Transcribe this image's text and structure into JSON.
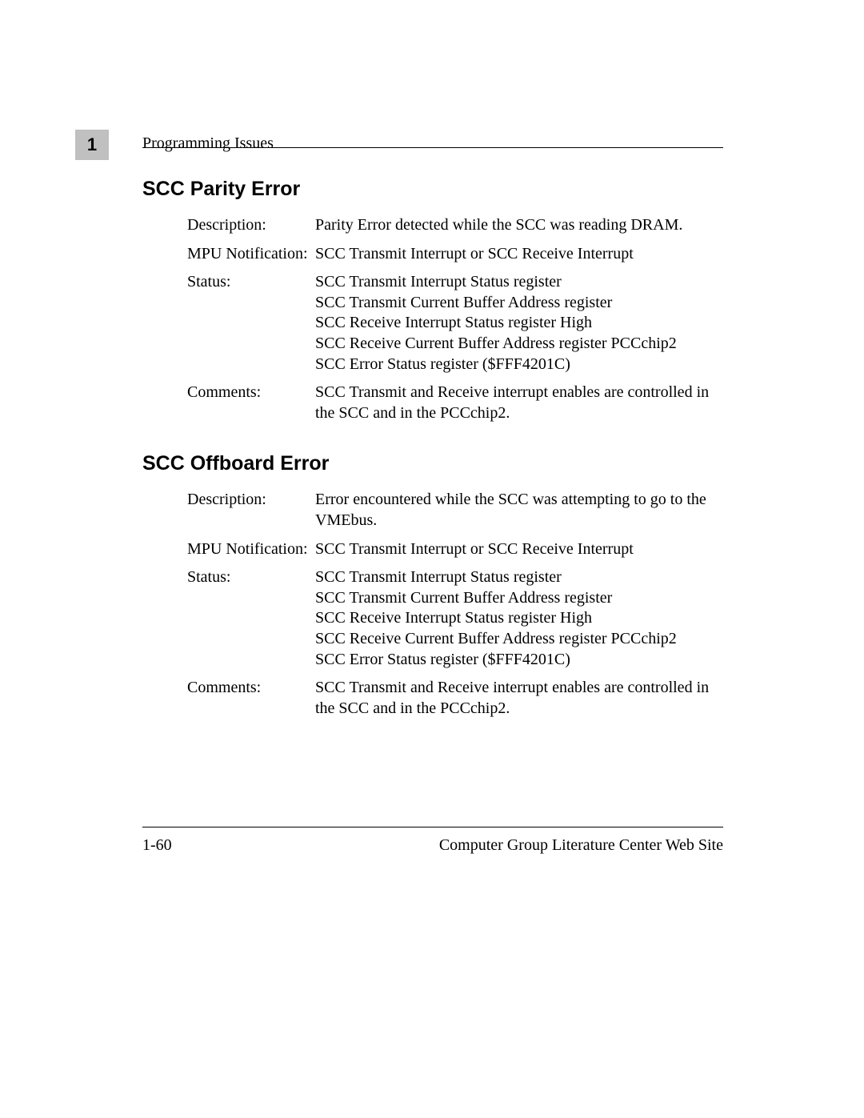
{
  "header": {
    "chapter_number": "1",
    "running_head": "Programming Issues"
  },
  "sections": [
    {
      "title": "SCC Parity Error",
      "rows": [
        {
          "label": "Description:",
          "lines": [
            "Parity Error detected while the SCC was reading DRAM."
          ]
        },
        {
          "label": "MPU Notification:",
          "lines": [
            "SCC Transmit Interrupt or SCC Receive Interrupt"
          ]
        },
        {
          "label": "Status:",
          "lines": [
            "SCC Transmit Interrupt Status register",
            "SCC Transmit Current Buffer Address register",
            "SCC Receive Interrupt Status register High",
            "SCC Receive Current Buffer Address register PCCchip2",
            "SCC Error Status register ($FFF4201C)"
          ]
        },
        {
          "label": "Comments:",
          "lines": [
            "SCC Transmit and Receive interrupt enables are controlled in the SCC and in the PCCchip2."
          ]
        }
      ]
    },
    {
      "title": "SCC Offboard Error",
      "rows": [
        {
          "label": "Description:",
          "lines": [
            "Error encountered while the SCC was attempting to go to the VMEbus."
          ]
        },
        {
          "label": "MPU Notification:",
          "lines": [
            "SCC Transmit Interrupt or SCC Receive Interrupt"
          ]
        },
        {
          "label": "Status:",
          "lines": [
            "SCC Transmit Interrupt Status register",
            "SCC Transmit Current Buffer Address register",
            "SCC Receive Interrupt Status register High",
            "SCC Receive Current Buffer Address register PCCchip2",
            "SCC Error Status register ($FFF4201C)"
          ]
        },
        {
          "label": "Comments:",
          "lines": [
            "SCC Transmit and Receive interrupt enables are controlled in the SCC and in the PCCchip2."
          ]
        }
      ]
    }
  ],
  "footer": {
    "left": "1-60",
    "right": "Computer Group Literature Center Web Site"
  }
}
